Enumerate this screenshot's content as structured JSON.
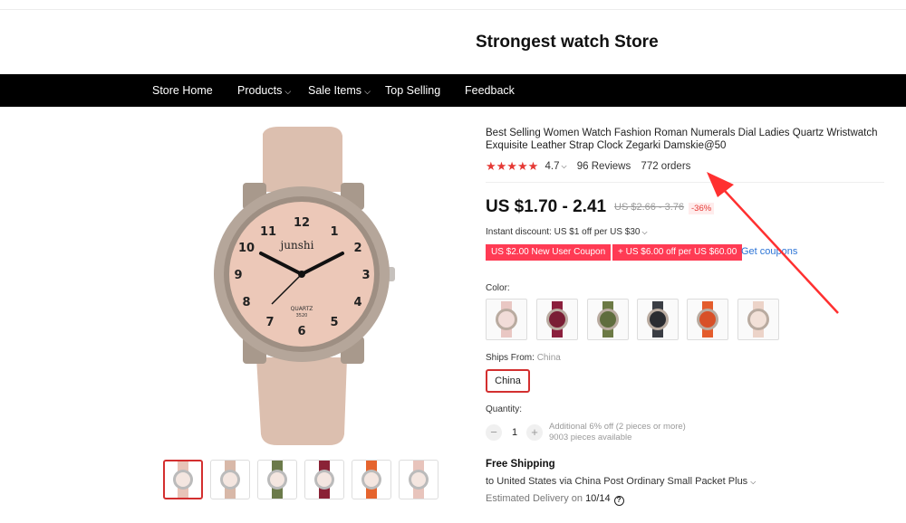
{
  "store": {
    "title": "Strongest watch Store"
  },
  "nav": {
    "items": [
      {
        "label": "Store Home",
        "dropdown": false
      },
      {
        "label": "Products",
        "dropdown": true
      },
      {
        "label": "Sale Items",
        "dropdown": true
      },
      {
        "label": "Top Selling",
        "dropdown": false
      },
      {
        "label": "Feedback",
        "dropdown": false
      }
    ]
  },
  "gallery": {
    "watch_brand": "junshi",
    "watch_text": "QUARTZ",
    "watch_code": "3520",
    "thumbnails": [
      {
        "color": "#e8c4b8",
        "selected": true
      },
      {
        "color": "#d8b8a8",
        "selected": false
      },
      {
        "color": "#6b7a4a",
        "selected": false
      },
      {
        "color": "#8a2236",
        "selected": false
      },
      {
        "color": "#e5642e",
        "selected": false
      },
      {
        "color": "#e8c4bc",
        "selected": false
      }
    ]
  },
  "product": {
    "title": "Best Selling Women Watch Fashion Roman Numerals Dial Ladies Quartz Wristwatch Exquisite Leather Strap Clock Zegarki Damskie@50",
    "stars": "★★★★★",
    "rating": "4.7",
    "reviews": "96 Reviews",
    "orders": "772 orders",
    "price": "US $1.70 - 2.41",
    "old_price": "US $2.66 - 3.76",
    "discount": "-36%",
    "instant_discount": "Instant discount: US $1 off per US $30",
    "coupons": [
      "US $2.00 New User Coupon",
      "+ US $6.00 off per US $60.00"
    ],
    "get_coupons": "Get coupons"
  },
  "options": {
    "color_label": "Color:",
    "colors": [
      {
        "name": "pink",
        "strap": "#e9c7c3",
        "dial": "#f1dcd8"
      },
      {
        "name": "wine",
        "strap": "#8b1f3d",
        "dial": "#7a1e35"
      },
      {
        "name": "green",
        "strap": "#6c7a45",
        "dial": "#5f6d3e"
      },
      {
        "name": "black",
        "strap": "#3a3d44",
        "dial": "#2a2c31"
      },
      {
        "name": "orange",
        "strap": "#e45c2c",
        "dial": "#d85028"
      },
      {
        "name": "beige",
        "strap": "#ecd3c8",
        "dial": "#f2e1d8"
      }
    ],
    "ships_from_label": "Ships From:",
    "ships_from_value": "China",
    "ships_from_button": "China"
  },
  "quantity": {
    "label": "Quantity:",
    "minus": "−",
    "value": "1",
    "plus": "+",
    "extra_line1": "Additional 6% off (2 pieces or more)",
    "extra_line2": "9003 pieces available"
  },
  "shipping": {
    "title": "Free Shipping",
    "description": "to United States via China Post Ordinary Small Packet Plus",
    "delivery_prefix": "Estimated Delivery on",
    "delivery_date": "10/14"
  }
}
